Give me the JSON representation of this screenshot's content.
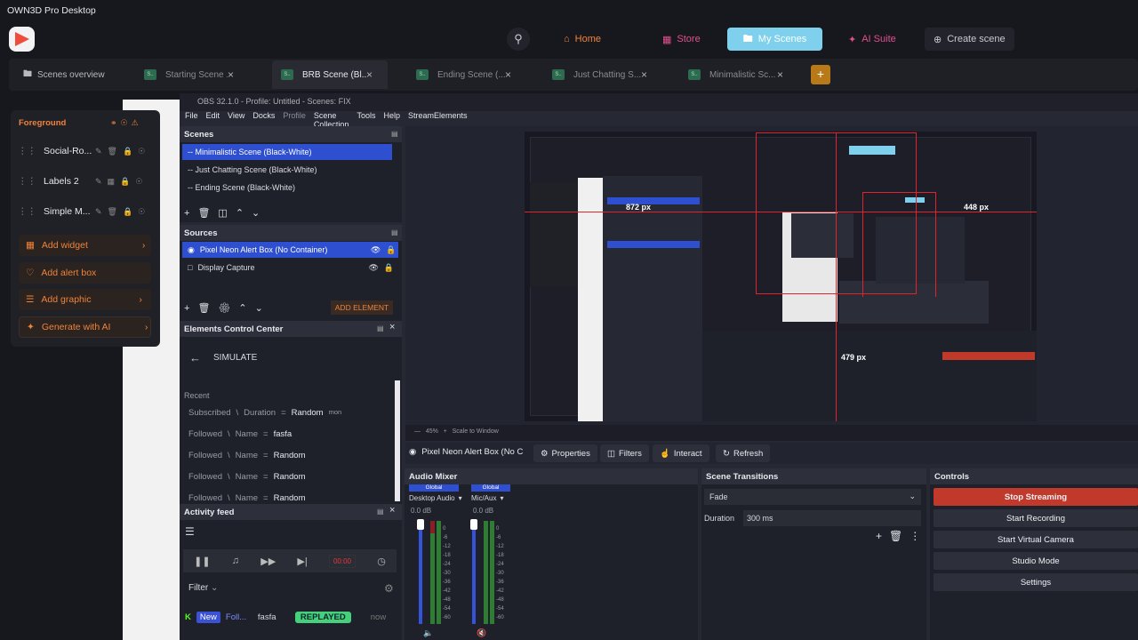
{
  "app": {
    "title": "OWN3D Pro Desktop"
  },
  "nav": {
    "home": "Home",
    "store": "Store",
    "my_scenes": "My Scenes",
    "ai_suite": "AI Suite",
    "create_scene": "Create scene"
  },
  "tabs": {
    "overview": "Scenes overview",
    "items": [
      "Starting Scene ...",
      "BRB Scene (Bl...",
      "Ending Scene (...",
      "Just Chatting S...",
      "Minimalistic Sc..."
    ],
    "badge": "S..",
    "add": "+"
  },
  "left_panel": {
    "header": "Foreground",
    "items": [
      "Social-Ro...",
      "Labels 2",
      "Simple M..."
    ],
    "buttons": [
      "Add widget",
      "Add alert box",
      "Add graphic",
      "Generate with AI"
    ]
  },
  "obs": {
    "title": "OBS 32.1.0 - Profile: Untitled - Scenes: FIX",
    "menu": [
      "File",
      "Edit",
      "View",
      "Docks",
      "Profile",
      "Scene Collection",
      "Tools",
      "Help",
      "StreamElements"
    ],
    "scenes": {
      "header": "Scenes",
      "items": [
        "-- Minimalistic Scene (Black-White)",
        "-- Just Chatting Scene (Black-White)",
        "-- Ending Scene (Black-White)"
      ]
    },
    "sources": {
      "header": "Sources",
      "items": [
        "Pixel Neon Alert Box (No Container)",
        "Display Capture"
      ],
      "add_element": "ADD ELEMENT"
    },
    "ecc": {
      "header": "Elements Control Center",
      "simulate": "SIMULATE",
      "recent": "Recent",
      "rows": [
        {
          "event": "Subscribed",
          "field": "Duration",
          "eq": "=",
          "value": "Random",
          "unit": "mon"
        },
        {
          "event": "Followed",
          "field": "Name",
          "eq": "=",
          "value": "fasfa",
          "unit": ""
        },
        {
          "event": "Followed",
          "field": "Name",
          "eq": "=",
          "value": "Random",
          "unit": ""
        },
        {
          "event": "Followed",
          "field": "Name",
          "eq": "=",
          "value": "Random",
          "unit": ""
        },
        {
          "event": "Followed",
          "field": "Name",
          "eq": "=",
          "value": "Random",
          "unit": ""
        }
      ]
    },
    "activity": {
      "header": "Activity feed",
      "timer": "00:00",
      "filter": "Filter",
      "feed_new": "New",
      "feed_type": "Foll...",
      "feed_name": "fasfa",
      "feed_status": "REPLAYED",
      "feed_time": "now"
    },
    "preview": {
      "px1": "872 px",
      "px2": "448 px",
      "px3": "479 px",
      "zoom": "45%",
      "scale": "Scale to Window"
    },
    "toolbar": {
      "source": "Pixel Neon Alert Box (No Co",
      "properties": "Properties",
      "filters": "Filters",
      "interact": "Interact",
      "refresh": "Refresh"
    },
    "audio": {
      "header": "Audio Mixer",
      "global": "Global",
      "ch1": "Desktop Audio",
      "ch2": "Mic/Aux",
      "db1": "0.0 dB",
      "db2": "0.0 dB",
      "scale": [
        "0",
        "-6",
        "-12",
        "-18",
        "-24",
        "-30",
        "-36",
        "-42",
        "-48",
        "-54",
        "-60"
      ]
    },
    "transitions": {
      "header": "Scene Transitions",
      "type": "Fade",
      "duration_label": "Duration",
      "duration": "300 ms"
    },
    "controls": {
      "header": "Controls",
      "stop": "Stop Streaming",
      "record": "Start Recording",
      "virtual": "Start Virtual Camera",
      "studio": "Studio Mode",
      "settings": "Settings"
    }
  },
  "colors": {
    "accent": "#7fd0ec",
    "orange": "#f0833a",
    "streaming": "#c0392b",
    "select": "#2e4fcf",
    "red": "#e0242e"
  }
}
